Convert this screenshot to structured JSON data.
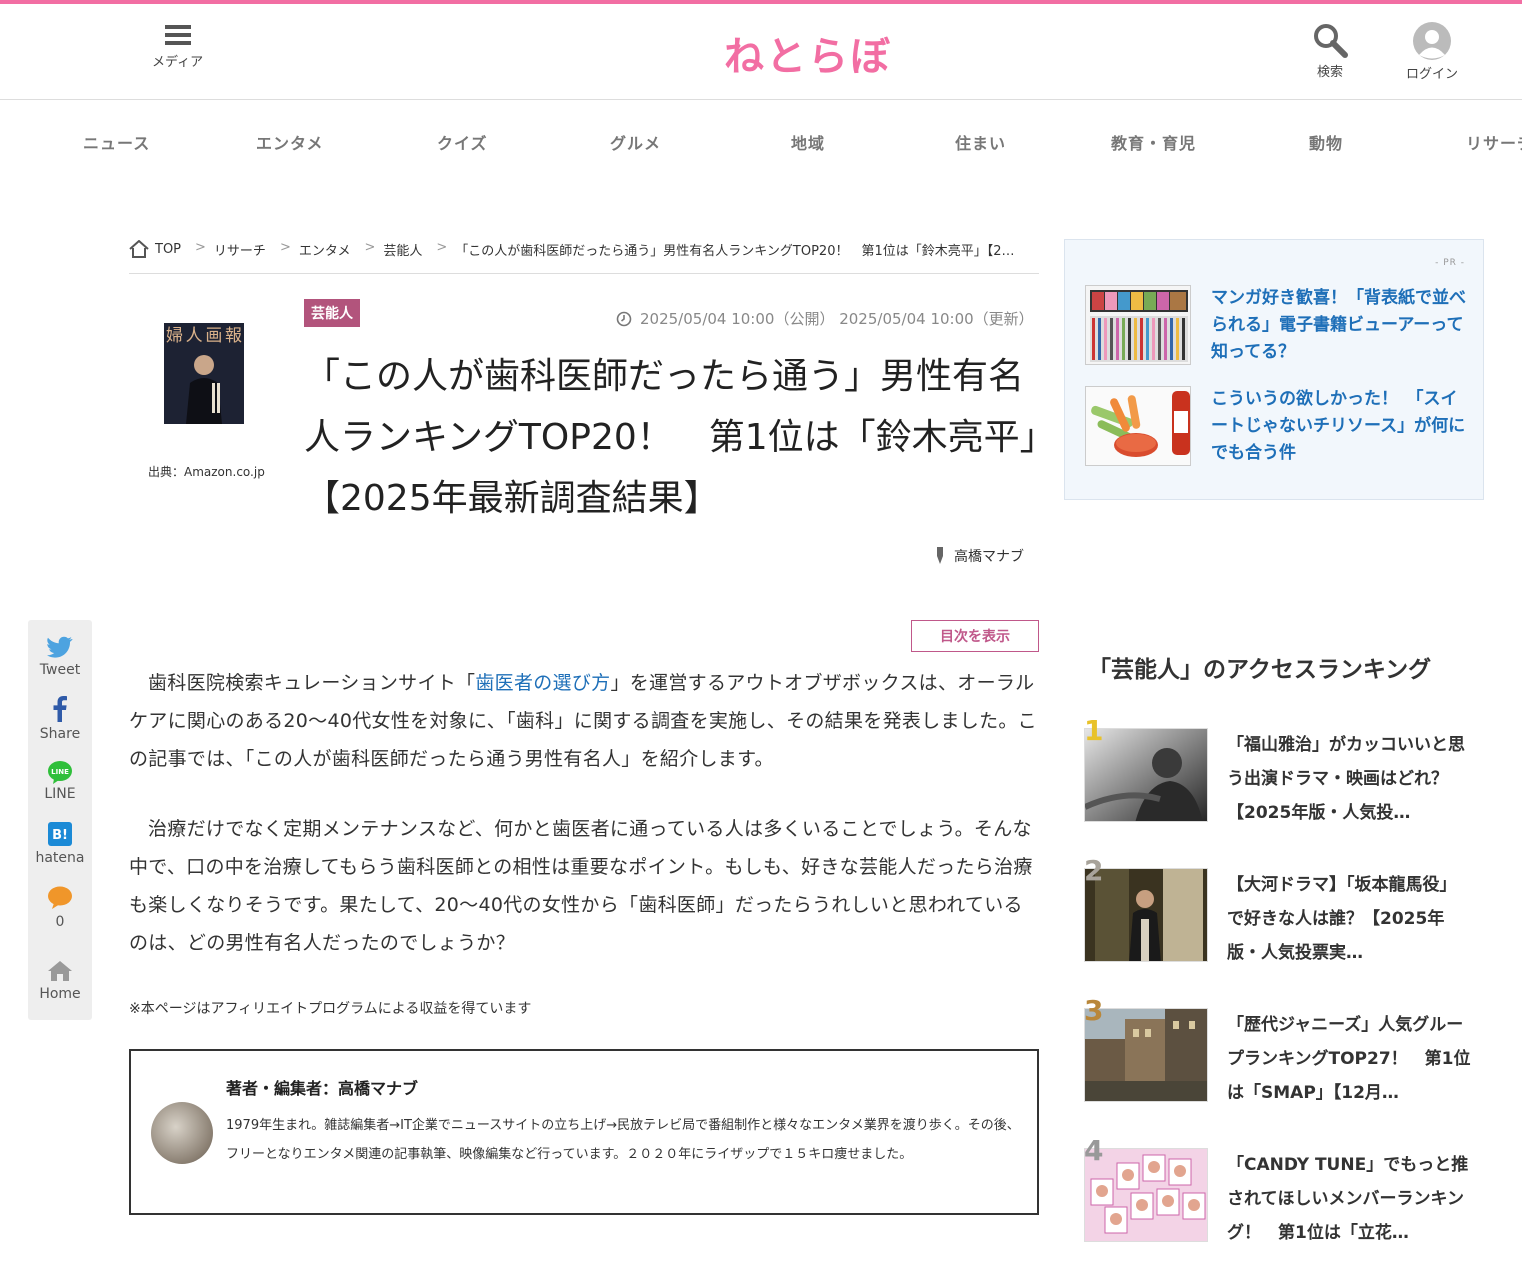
{
  "header": {
    "menu_label": "メディア",
    "logo": "ねとらぼ",
    "search_label": "検索",
    "login_label": "ログイン"
  },
  "gnav": [
    "ニュース",
    "エンタメ",
    "クイズ",
    "グルメ",
    "地域",
    "住まい",
    "教育・育児",
    "動物",
    "リサーチ"
  ],
  "breadcrumb": {
    "home": "TOP",
    "items": [
      "リサーチ",
      "エンタメ",
      "芸能人",
      "「この人が歯科医師だったら通う」男性有名人ランキングTOP20！　第1位は「鈴木亮平」【2…"
    ]
  },
  "article": {
    "category": "芸能人",
    "thumb_caption": "出典：Amazon.co.jp",
    "thumb_magazine": "婦人画報",
    "dates": "2025/05/04 10:00（公開）  2025/05/04 10:00（更新）",
    "title": "「この人が歯科医師だったら通う」男性有名人ランキングTOP20！　第1位は「鈴木亮平」【2025年最新調査結果】",
    "author": "高橋マナブ",
    "toc_label": "目次を表示",
    "p1_pre": "歯科医院検索キュレーションサイト「",
    "p1_link": "歯医者の選び方",
    "p1_post": "」を運営するアウトオブザボックスは、オーラルケアに関心のある20～40代女性を対象に、「歯科」に関する調査を実施し、その結果を発表しました。この記事では、「この人が歯科医師だったら通う男性有名人」を紹介します。",
    "p2": "治療だけでなく定期メンテナンスなど、何かと歯医者に通っている人は多くいることでしょう。そんな中で、口の中を治療してもらう歯科医師との相性は重要なポイント。もしも、好きな芸能人だったら治療も楽しくなりそうです。果たして、20～40代の女性から「歯科医師」だったらうれしいと思われているのは、どの男性有名人だったのでしょうか？",
    "affiliate": "※本ページはアフィリエイトプログラムによる収益を得ています"
  },
  "author_box": {
    "name": "著者・編集者：高橋マナブ",
    "bio": "1979年生まれ。雑誌編集者→IT企業でニュースサイトの立ち上げ→民放テレビ局で番組制作と様々なエンタメ業界を渡り歩く。その後、フリーとなりエンタメ関連の記事執筆、映像編集など行っています。２０２０年にライザップで１５キロ痩せました。"
  },
  "share": {
    "tweet": "Tweet",
    "share": "Share",
    "line": "LINE",
    "line_icon_text": "LINE",
    "hatena": "hatena",
    "hatena_icon_text": "B!",
    "comments": "0",
    "home": "Home"
  },
  "pr": {
    "tag": "- PR -",
    "items": [
      {
        "text": "マンガ好き歓喜！「背表紙で並べられる」電子書籍ビューアーって知ってる？"
      },
      {
        "text": "こういうの欲しかった！　「スイートじゃないチリソース」が何にでも合う件"
      }
    ]
  },
  "ranking": {
    "title": "「芸能人」のアクセスランキング",
    "items": [
      {
        "num": "1",
        "text": "「福山雅治」がカッコいいと思う出演ドラマ・映画はどれ？【2025年版・人気投…",
        "color": "#e8c22a"
      },
      {
        "num": "2",
        "text": "【大河ドラマ】「坂本龍馬役」で好きな人は誰？【2025年版・人気投票実…",
        "color": "#a8a39a"
      },
      {
        "num": "3",
        "text": "「歴代ジャニーズ」人気グループランキングTOP27！　第1位は「SMAP」【12月…",
        "color": "#b9873a"
      },
      {
        "num": "4",
        "text": "「CANDY TUNE」でもっと推されてほしいメンバーランキング！　第1位は「立花…",
        "color": "#999999"
      }
    ]
  },
  "colors": {
    "brand_pink": "#f26ea3",
    "category": "#b2547c",
    "link_blue": "#1e6fb8"
  }
}
